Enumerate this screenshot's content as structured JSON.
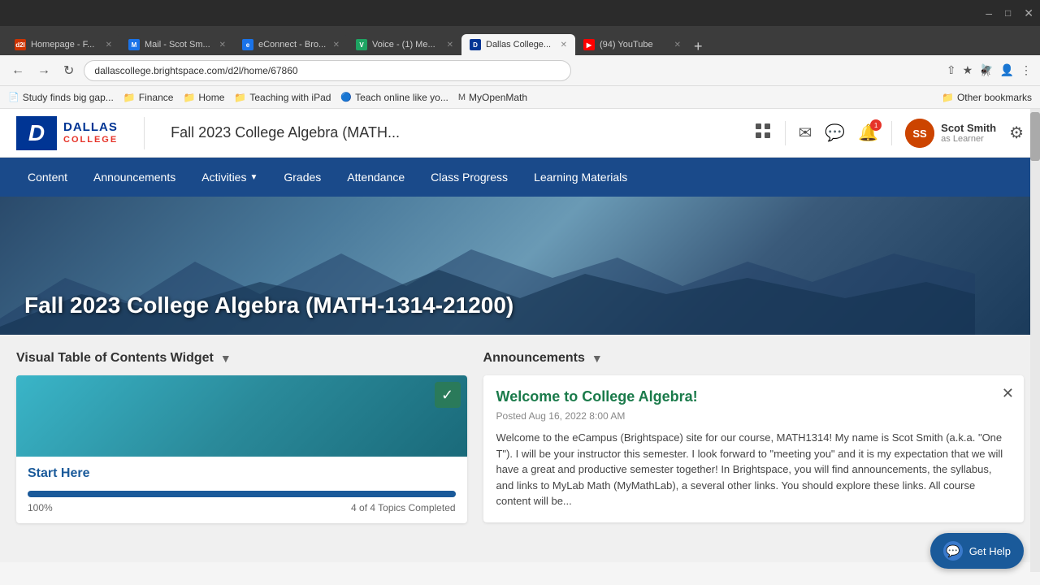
{
  "browser": {
    "tabs": [
      {
        "id": "tab1",
        "label": "Homepage - F...",
        "active": false,
        "icon_color": "#cc3300",
        "icon_letter": "d2l"
      },
      {
        "id": "tab2",
        "label": "Mail - Scot Sm...",
        "active": false,
        "icon_color": "#1a73e8",
        "icon_letter": "M"
      },
      {
        "id": "tab3",
        "label": "eConnect - Bro...",
        "active": false,
        "icon_color": "#1a73e8",
        "icon_letter": "e"
      },
      {
        "id": "tab4",
        "label": "Voice - (1) Me...",
        "active": false,
        "icon_color": "#1ea362",
        "icon_letter": "V"
      },
      {
        "id": "tab5",
        "label": "Dallas College...",
        "active": true,
        "icon_color": "#003594",
        "icon_letter": "D"
      },
      {
        "id": "tab6",
        "label": "(94) YouTube",
        "active": false,
        "icon_color": "#ff0000",
        "icon_letter": "▶"
      }
    ],
    "address": "dallascollege.brightspace.com/d2l/home/67860",
    "bookmarks": [
      {
        "label": "Study finds big gap...",
        "type": "page"
      },
      {
        "label": "Finance",
        "type": "page"
      },
      {
        "label": "Home",
        "type": "folder"
      },
      {
        "label": "Teaching with iPad",
        "type": "folder"
      },
      {
        "label": "Teach online like yo...",
        "type": "page"
      },
      {
        "label": "MyOpenMath",
        "type": "page"
      },
      {
        "label": "Other bookmarks",
        "type": "folder"
      }
    ]
  },
  "lms": {
    "logo": {
      "letter": "D",
      "name_top": "DALLAS",
      "name_bottom": "COLLEGE"
    },
    "header": {
      "course_title": "Fall 2023 College Algebra (MATH...",
      "user_name": "Scot Smith",
      "user_role": "as Learner",
      "user_initials": "SS"
    },
    "nav": {
      "items": [
        {
          "label": "Content",
          "has_dropdown": false
        },
        {
          "label": "Announcements",
          "has_dropdown": false
        },
        {
          "label": "Activities",
          "has_dropdown": true
        },
        {
          "label": "Grades",
          "has_dropdown": false
        },
        {
          "label": "Attendance",
          "has_dropdown": false
        },
        {
          "label": "Class Progress",
          "has_dropdown": false
        },
        {
          "label": "Learning Materials",
          "has_dropdown": false
        }
      ]
    },
    "hero": {
      "title": "Fall 2023 College Algebra (MATH-1314-21200)"
    },
    "widgets": {
      "left": {
        "header": "Visual Table of Contents Widget",
        "card": {
          "title": "Start Here",
          "progress_percent": 100,
          "progress_label": "100%",
          "topics_label": "4 of 4 Topics Completed"
        }
      },
      "right": {
        "header": "Announcements",
        "announcement": {
          "title": "Welcome to College Algebra!",
          "date": "Posted Aug 16, 2022 8:00 AM",
          "body": "Welcome to the eCampus (Brightspace) site for our course, MATH1314! My name is Scot Smith (a.k.a. \"One T\").  I will be your instructor this semester.  I look forward to \"meeting you\" and it is my expectation that we will have a great and productive semester together!  In Brightspace, you will find announcements, the syllabus, and links to MyLab Math (MyMathLab), a several other links.  You should explore these links.  All course content will be..."
        }
      }
    },
    "get_help": {
      "label": "Get Help"
    }
  }
}
